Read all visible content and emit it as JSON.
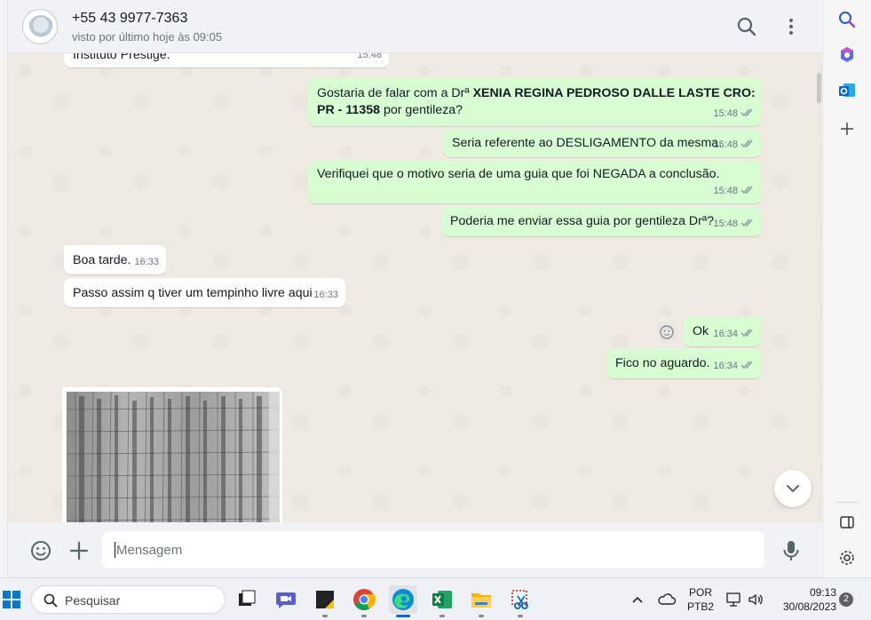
{
  "header": {
    "contact_name": "+55 43 9977-7363",
    "contact_status": "visto por último hoje às 09:05",
    "icons": [
      "search-icon",
      "menu-icon"
    ]
  },
  "messages": [
    {
      "id": "m0",
      "direction": "in",
      "text": "Instituto Prestige.",
      "time": "15:48"
    },
    {
      "id": "m1",
      "direction": "out",
      "text_before": "Gostaria de falar com a Drª ",
      "text_bold": "XENIA REGINA PEDROSO DALLE LASTE CRO: PR - 11358",
      "text_after": " por gentileza?",
      "time": "15:48",
      "status": "read"
    },
    {
      "id": "m2",
      "direction": "out",
      "text": "Seria referente ao DESLIGAMENTO da mesma.",
      "time": "15:48",
      "status": "read"
    },
    {
      "id": "m3",
      "direction": "out",
      "text": "Verifiquei que o motivo seria de uma guia que foi NEGADA a conclusão.",
      "time": "15:48",
      "status": "read"
    },
    {
      "id": "m4",
      "direction": "out",
      "text": "Poderia me enviar essa guia por gentileza Drª?",
      "time": "15:48",
      "status": "read"
    },
    {
      "id": "m5",
      "direction": "in",
      "text": "Boa tarde.",
      "time": "16:33"
    },
    {
      "id": "m6",
      "direction": "in",
      "text": "Passo assim q tiver um tempinho livre aqui",
      "time": "16:33"
    },
    {
      "id": "m7",
      "direction": "out",
      "text": "Ok",
      "time": "16:34",
      "status": "read"
    },
    {
      "id": "m8",
      "direction": "out",
      "text": "Fico no aguardo.",
      "time": "16:34",
      "status": "read"
    },
    {
      "id": "m9",
      "direction": "in",
      "type": "image",
      "text": ""
    }
  ],
  "composer": {
    "placeholder": "Mensagem",
    "icons": [
      "emoji-icon",
      "attach-plus-icon",
      "microphone-icon"
    ]
  },
  "right_sidebar": {
    "icons": [
      "search-icon",
      "copilot-icon",
      "outlook-icon",
      "add-icon",
      "sidebar-toggle-icon",
      "settings-icon"
    ]
  },
  "taskbar": {
    "search_label": "Pesquisar",
    "apps": [
      "windows-start-icon",
      "task-view-icon",
      "meet-icon",
      "sticky-notes-icon",
      "chrome-icon",
      "edge-icon",
      "excel-icon",
      "file-explorer-icon",
      "snipping-tool-icon"
    ],
    "lang_top": "POR",
    "lang_bottom": "PTB2",
    "time": "09:13",
    "date": "30/08/2023",
    "notification_count": "2"
  },
  "colors": {
    "chat_bg": "#efeae2",
    "outgoing_bubble": "#d9fdd3",
    "incoming_bubble": "#ffffff",
    "read_ticks": "#53bdeb",
    "header_bg": "#f0f2f5"
  }
}
